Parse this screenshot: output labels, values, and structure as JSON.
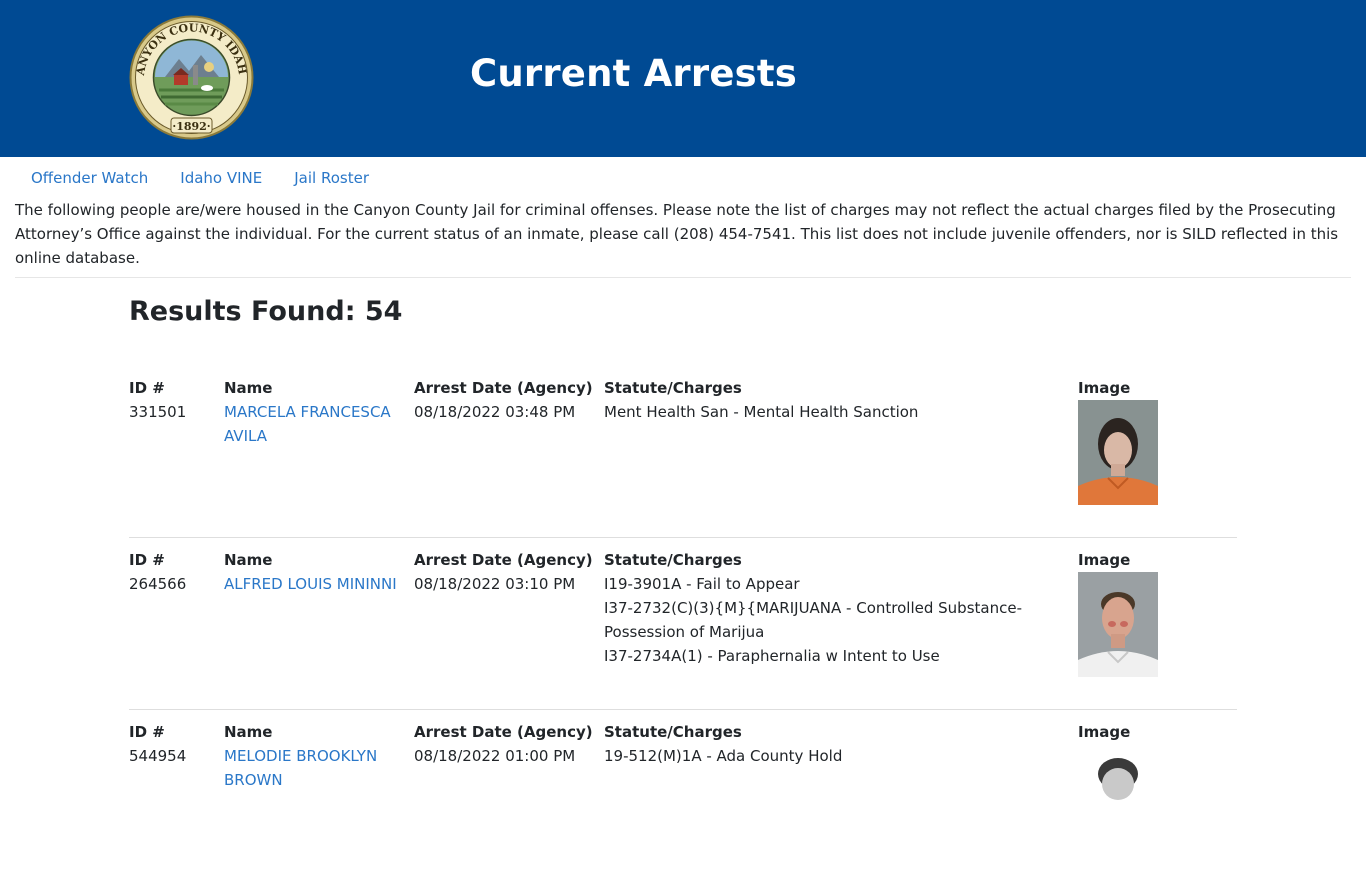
{
  "header": {
    "title": "Current Arrests",
    "seal_text": "CANYON COUNTY IDAHO",
    "seal_year": "1892"
  },
  "nav": [
    {
      "label": "Offender Watch"
    },
    {
      "label": "Idaho VINE"
    },
    {
      "label": "Jail Roster"
    }
  ],
  "intro": "The following people are/were housed in the Canyon County Jail for criminal offenses. Please note the list of charges may not reflect the actual charges filed by the Prosecuting Attorney’s Office against the individual. For the current status of an inmate, please call (208) 454-7541. This list does not include juvenile offenders, nor is SILD reflected in this online database.",
  "results_label": "Results Found: 54",
  "columns": {
    "id": "ID #",
    "name": "Name",
    "date": "Arrest Date (Agency)",
    "charges": "Statute/Charges",
    "image": "Image"
  },
  "records": [
    {
      "id": "331501",
      "name": "MARCELA FRANCESCA AVILA",
      "date": "08/18/2022 03:48 PM",
      "charges": [
        "Ment Health San - Mental Health Sanction"
      ]
    },
    {
      "id": "264566",
      "name": "ALFRED LOUIS MININNI",
      "date": "08/18/2022 03:10 PM",
      "charges": [
        "I19-3901A - Fail to Appear",
        "I37-2732(C)(3){M}{MARIJUANA - Controlled Substance-Possession of Marijua",
        "I37-2734A(1) - Paraphernalia w Intent to Use"
      ]
    },
    {
      "id": "544954",
      "name": "MELODIE BROOKLYN BROWN",
      "date": "08/18/2022 01:00 PM",
      "charges": [
        "19-512(M)1A - Ada County Hold"
      ]
    }
  ]
}
